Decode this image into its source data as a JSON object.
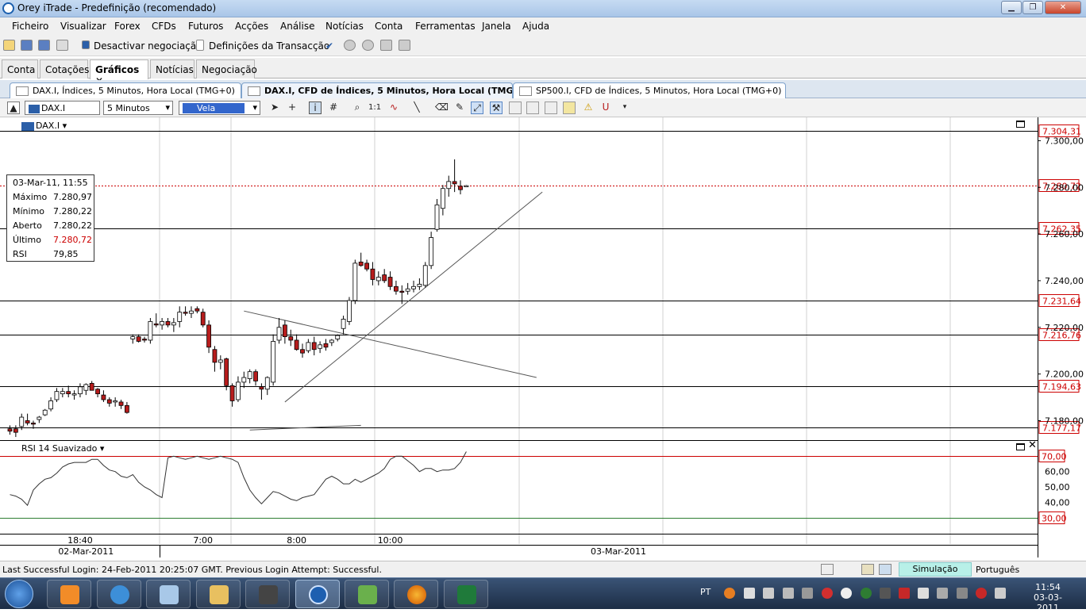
{
  "window": {
    "title": "Orey iTrade - Predefinição (recomendado)"
  },
  "menu": [
    "Ficheiro",
    "Visualizar",
    "Forex",
    "CFDs",
    "Futuros",
    "Acções",
    "Análise",
    "Notícias",
    "Conta",
    "Ferramentas",
    "Janela",
    "Ajuda"
  ],
  "toolbar": {
    "deactivate_label": "Desactivar negociação",
    "transaction_label": "Definições da Transacção"
  },
  "main_tabs": [
    {
      "label": "Conta",
      "active": false
    },
    {
      "label": "Cotações",
      "active": false
    },
    {
      "label": "Gráficos",
      "active": true,
      "close": "✕"
    },
    {
      "label": "Notícias",
      "active": false
    },
    {
      "label": "Negociação",
      "active": false
    }
  ],
  "chart_tabs": [
    {
      "label": "DAX.I, Índices, 5 Minutos, Hora Local (TMG+0)",
      "active": false
    },
    {
      "label": "DAX.I, CFD de Índices, 5 Minutos, Hora Local (TMG+0)",
      "active": true
    },
    {
      "label": "SP500.I, CFD de Índices, 5 Minutos, Hora Local (TMG+0)",
      "active": false
    }
  ],
  "chart_toolbar": {
    "symbol": "DAX.I",
    "interval": "5 Minutos",
    "chart_style": "Vela"
  },
  "instrument_label": "DAX.I",
  "indicator_label": "RSI 14 Suavizado",
  "info_box": {
    "datetime": "03-Mar-11, 11:55",
    "rows": [
      {
        "label": "Máximo",
        "value": "7.280,97"
      },
      {
        "label": "Mínimo",
        "value": "7.280,22"
      },
      {
        "label": "Aberto",
        "value": "7.280,22"
      },
      {
        "label": "Último",
        "value": "7.280,72"
      },
      {
        "label": "RSI",
        "value": "79,85"
      }
    ]
  },
  "colors": {
    "bull": "#2e7d32",
    "bear": "#b71c1c",
    "last_price": "#cc0000",
    "accent": "#2b5fa8"
  },
  "chart_data": {
    "type": "candlestick",
    "instrument": "DAX.I",
    "ylim": [
      7172,
      7310
    ],
    "y_ticks": [
      "7.300,00",
      "7.280,00",
      "7.260,00",
      "7.240,00",
      "7.220,00",
      "7.200,00",
      "7.180,00"
    ],
    "horizontal_levels": [
      {
        "value": 7304.31,
        "label": "7.304,31"
      },
      {
        "value": 7262.35,
        "label": "7.262,35"
      },
      {
        "value": 7231.64,
        "label": "7.231,64"
      },
      {
        "value": 7216.76,
        "label": "7.216,76"
      },
      {
        "value": 7194.63,
        "label": "7.194,63"
      },
      {
        "value": 7177.17,
        "label": "7.177,17"
      }
    ],
    "last_price": {
      "value": 7280.72,
      "label": "7.280,72"
    },
    "x_labels": [
      {
        "label": "18:40",
        "index": 12
      },
      {
        "label": "7:00",
        "index": 33
      },
      {
        "label": "8:00",
        "index": 49
      },
      {
        "label": "10:00",
        "index": 65
      }
    ],
    "date_labels": [
      {
        "label": "02-Mar-2011",
        "index": 13
      },
      {
        "label": "03-Mar-2011",
        "index": 104
      }
    ],
    "ohlc": [
      [
        7176.5,
        7178,
        7174,
        7175.5
      ],
      [
        7176.5,
        7178,
        7173,
        7175
      ],
      [
        7177.5,
        7183,
        7176,
        7181.5
      ],
      [
        7180,
        7183,
        7178,
        7179
      ],
      [
        7179,
        7180,
        7176.5,
        7178.5
      ],
      [
        7180.5,
        7182,
        7179,
        7181.5
      ],
      [
        7182.5,
        7185,
        7182,
        7184.5
      ],
      [
        7185,
        7190,
        7184,
        7188.5
      ],
      [
        7189,
        7194,
        7188,
        7192.5
      ],
      [
        7191.5,
        7194,
        7190,
        7192.5
      ],
      [
        7192.5,
        7195,
        7190,
        7191.5
      ],
      [
        7191,
        7193,
        7189,
        7191.5
      ],
      [
        7191.5,
        7196,
        7190,
        7194.5
      ],
      [
        7193,
        7196,
        7191,
        7195.5
      ],
      [
        7196,
        7197,
        7194,
        7193
      ],
      [
        7193.5,
        7194,
        7190,
        7191.5
      ],
      [
        7191,
        7193,
        7188,
        7189
      ],
      [
        7189,
        7190,
        7186,
        7187.5
      ],
      [
        7188,
        7190,
        7186,
        7188.5
      ],
      [
        7188,
        7189,
        7185,
        7186.5
      ],
      [
        7186.5,
        7188,
        7183,
        7183.5
      ],
      [
        7215,
        7217,
        7213,
        7216
      ],
      [
        7216,
        7217,
        7213.5,
        7214
      ],
      [
        7215,
        7216,
        7213.5,
        7214.5
      ],
      [
        7214.5,
        7224,
        7213,
        7222.5
      ],
      [
        7221.5,
        7226,
        7220,
        7221
      ],
      [
        7221,
        7224,
        7219,
        7222.5
      ],
      [
        7222.5,
        7224,
        7220,
        7221
      ],
      [
        7221,
        7224,
        7218,
        7222
      ],
      [
        7222.5,
        7229,
        7220,
        7226.5
      ],
      [
        7226.5,
        7229,
        7225,
        7226
      ],
      [
        7226,
        7229,
        7224,
        7227
      ],
      [
        7228,
        7229,
        7226,
        7227
      ],
      [
        7226.5,
        7228,
        7220,
        7221
      ],
      [
        7221,
        7223,
        7209,
        7211.5
      ],
      [
        7210.5,
        7212,
        7201,
        7205
      ],
      [
        7205,
        7208,
        7202,
        7206
      ],
      [
        7206.5,
        7207,
        7193,
        7195
      ],
      [
        7195,
        7196,
        7186,
        7188.5
      ],
      [
        7189,
        7199,
        7188,
        7196.5
      ],
      [
        7196.5,
        7201,
        7194,
        7198.5
      ],
      [
        7198,
        7202,
        7196,
        7201
      ],
      [
        7201,
        7202,
        7195,
        7197
      ],
      [
        7194.5,
        7196,
        7189,
        7193.5
      ],
      [
        7193.5,
        7199,
        7191,
        7198.5
      ],
      [
        7196.5,
        7217,
        7195,
        7214
      ],
      [
        7214.5,
        7224,
        7213,
        7220
      ],
      [
        7221,
        7223,
        7213,
        7216
      ],
      [
        7216,
        7219,
        7212,
        7214.5
      ],
      [
        7214.5,
        7217,
        7210,
        7210.5
      ],
      [
        7210.5,
        7213,
        7207,
        7209
      ],
      [
        7210,
        7215,
        7209,
        7213.5
      ],
      [
        7213.5,
        7216,
        7208,
        7210.5
      ],
      [
        7211,
        7214,
        7209,
        7212.5
      ],
      [
        7213,
        7215,
        7210,
        7211.5
      ],
      [
        7213.5,
        7215,
        7212,
        7214.5
      ],
      [
        7215,
        7217,
        7214,
        7216.5
      ],
      [
        7219.5,
        7225,
        7217,
        7223.5
      ],
      [
        7222.5,
        7233,
        7221,
        7231.5
      ],
      [
        7231.5,
        7249,
        7230,
        7247.5
      ],
      [
        7248,
        7252,
        7246,
        7246.5
      ],
      [
        7247.5,
        7249,
        7244,
        7245
      ],
      [
        7245,
        7248,
        7238,
        7240.5
      ],
      [
        7240,
        7244,
        7238,
        7241.5
      ],
      [
        7242.5,
        7245,
        7239,
        7240
      ],
      [
        7241.5,
        7244,
        7236,
        7237.5
      ],
      [
        7237.5,
        7240,
        7234,
        7235.5
      ],
      [
        7235.5,
        7238,
        7230,
        7235
      ],
      [
        7235.5,
        7239,
        7234,
        7236.5
      ],
      [
        7236.5,
        7240,
        7235,
        7237.5
      ],
      [
        7237.5,
        7241,
        7236,
        7238.5
      ],
      [
        7238,
        7248,
        7237,
        7246.5
      ],
      [
        7246.5,
        7261,
        7245,
        7258.5
      ],
      [
        7262,
        7275,
        7261,
        7272.5
      ],
      [
        7271,
        7281,
        7268,
        7279.5
      ],
      [
        7279.5,
        7285,
        7276,
        7282.5
      ],
      [
        7282.5,
        7292,
        7278,
        7281.5
      ],
      [
        7280.5,
        7283,
        7277,
        7279
      ],
      [
        7280.22,
        7280.97,
        7280.22,
        7280.72
      ]
    ],
    "rsi": {
      "name": "RSI 14 Suavizado",
      "ylim": [
        20,
        80
      ],
      "y_ticks": [
        "60,00",
        "50,00",
        "40,00"
      ],
      "levels": [
        {
          "value": 70,
          "label": "70,00"
        },
        {
          "value": 30,
          "label": "30,00"
        }
      ],
      "values": [
        45,
        44,
        42,
        38,
        48,
        52,
        55,
        56,
        59,
        63,
        65,
        66,
        66,
        66,
        68,
        68,
        64,
        61,
        60,
        57,
        56,
        58,
        53,
        50,
        48,
        45,
        43,
        69,
        70,
        69,
        68,
        69,
        70,
        69,
        68,
        69,
        70,
        69,
        68,
        66,
        56,
        48,
        43,
        39,
        43,
        47,
        46,
        44,
        42,
        41,
        43,
        44,
        45,
        50,
        55,
        57,
        55,
        52,
        52,
        55,
        53,
        55,
        57,
        59,
        62,
        68,
        70,
        70,
        67,
        64,
        60,
        62,
        62,
        60,
        61,
        61,
        62,
        66,
        73
      ]
    },
    "trendlines": [
      {
        "from": [
          47,
          7188
        ],
        "to": [
          91,
          7278
        ]
      },
      {
        "from": [
          40,
          7227
        ],
        "to": [
          90,
          7198.5
        ]
      },
      {
        "from": [
          41,
          7176
        ],
        "to": [
          60,
          7178
        ]
      }
    ]
  },
  "statusbar": {
    "message": "Last Successful Login: 24-Feb-2011 20:25:07 GMT. Previous Login Attempt: Successful.",
    "mode": "Simulação",
    "language": "Português"
  },
  "taskbar": {
    "language": "PT",
    "time": "11:54",
    "date": "03-03-2011"
  }
}
